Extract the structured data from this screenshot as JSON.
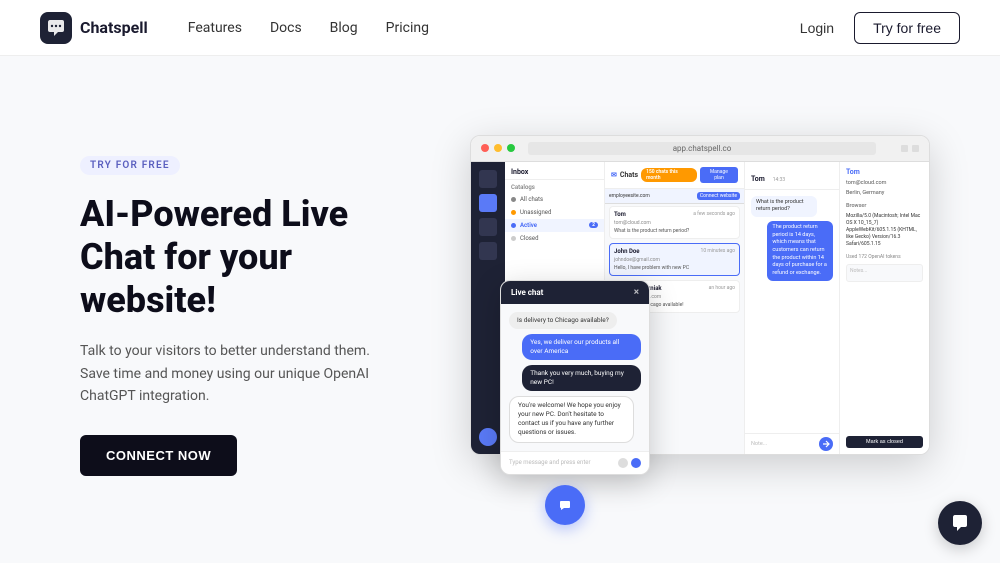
{
  "nav": {
    "logo_text": "Chatspell",
    "links": [
      "Features",
      "Docs",
      "Blog",
      "Pricing"
    ],
    "login_label": "Login",
    "try_free_label": "Try for free"
  },
  "hero": {
    "badge_label": "TRY FOR FREE",
    "title": "AI-Powered Live Chat for your website!",
    "description": "Talk to your visitors to better understand them. Save time and money using our unique OpenAI ChatGPT integration.",
    "cta_label": "CONNECT NOW"
  },
  "browser": {
    "url": "app.chatspell.co"
  },
  "inbox": {
    "title": "Inbox",
    "sections": [
      "Catalogs",
      "All chats",
      "Unassigned",
      "Active",
      "Closed"
    ],
    "active_badge": "2"
  },
  "chats_panel": {
    "title": "Chats",
    "count_label": "150 chats this month",
    "manage_plan": "Manage plan",
    "website": "employeesite.com",
    "connect_label": "Connect website",
    "items": [
      {
        "name": "Tom",
        "email": "tom@cloud.com",
        "time": "a few seconds ago",
        "preview": "What is the product return period?"
      },
      {
        "name": "John Doe",
        "email": "johndoe@gmail.com",
        "time": "10 minutes ago",
        "preview": "Hello, I have problem with new PC"
      },
      {
        "name": "Mateusz Wozniak",
        "email": "mateusz@gmail.com",
        "time": "an hour ago",
        "preview": "Is delivery to Chicago available!"
      }
    ]
  },
  "main_chat": {
    "contact_name": "Tom",
    "time_label": "14:33",
    "messages": [
      {
        "text": "What is the product return period?",
        "type": "incoming"
      },
      {
        "text": "The product return period is 14 days, which means that customers can return the product within 14 days of purchase for a refund or exchange.",
        "type": "outgoing"
      }
    ],
    "input_placeholder": "Note..."
  },
  "info_panel": {
    "name": "Tom",
    "email": "tom@cloud.com",
    "location": "Berlin, Germany",
    "browser_info": "Mozilla/5.0 (Macintosh; Intel Mac OS X 10_15_7) AppleWebKit/605.1.15 (KHTML, like Gecko) Version/16.3 Safari/605.1.15",
    "tokens_used": "Used 172 OpenAI tokens",
    "notes_placeholder": "Notes...",
    "mark_closed_label": "Mark as closed"
  },
  "livechat_popup": {
    "title": "Live chat",
    "close_icon": "×",
    "messages": [
      {
        "text": "Is delivery to Chicago available?",
        "type": "user"
      },
      {
        "text": "Yes, we deliver our products all over America",
        "type": "agent"
      },
      {
        "text": "Thank you very much, buying my new PC!",
        "type": "agent2"
      },
      {
        "text": "You're welcome! We hope you enjoy your new PC. Don't hesitate to contact us if you have any further questions or issues.",
        "type": "long"
      }
    ],
    "input_placeholder": "Type message and press enter"
  },
  "support_widget": {
    "icon": "💬"
  }
}
